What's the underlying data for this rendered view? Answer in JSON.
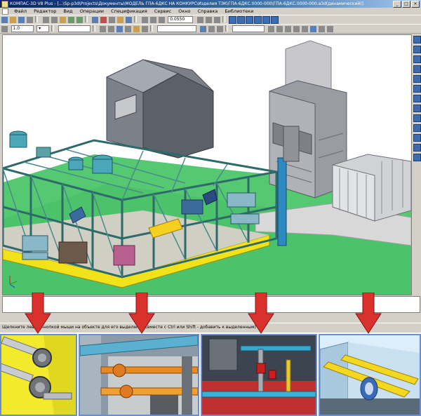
{
  "window": {
    "title": "КОМПАС-3D V8 Plus - [...\\Sp-p3d\\Projects\\Документы\\МОДЕЛЬ ГПА-6ДКС НА КОНКУРС\\Изделия ТЭК\\ГПА-6ДКС.0000-000\\ГПА-6ДКС.0000-000.a3d(динамический)]",
    "controls": [
      "_",
      "□",
      "×"
    ]
  },
  "menu": {
    "items": [
      "Файл",
      "Редактор",
      "Вид",
      "Операции",
      "Спецификация",
      "Сервис",
      "Окно",
      "Справка",
      "Библиотеки"
    ]
  },
  "toolbar": {
    "zoom_value": "0.0550",
    "step_value": "1.0"
  },
  "statusbar": {
    "text": "Щелкните левой кнопкой мыши на объекте для его выделения (вместе с Ctrl или Shift - добавить к выделенным)"
  },
  "colors": {
    "sky": "#ffffff",
    "ground": "#4cc26a",
    "frame": "#3a7a7a",
    "platform": "#f2e21a",
    "highlight_arrow": "#d9312b",
    "panel_border": "#6a8ecf"
  },
  "callouts": [
    {
      "name": "detail-flanged-pipes",
      "icon": "down-arrow-icon"
    },
    {
      "name": "detail-piping-rack",
      "icon": "down-arrow-icon"
    },
    {
      "name": "detail-valves",
      "icon": "down-arrow-icon"
    },
    {
      "name": "detail-wall-penetration",
      "icon": "down-arrow-icon"
    }
  ]
}
